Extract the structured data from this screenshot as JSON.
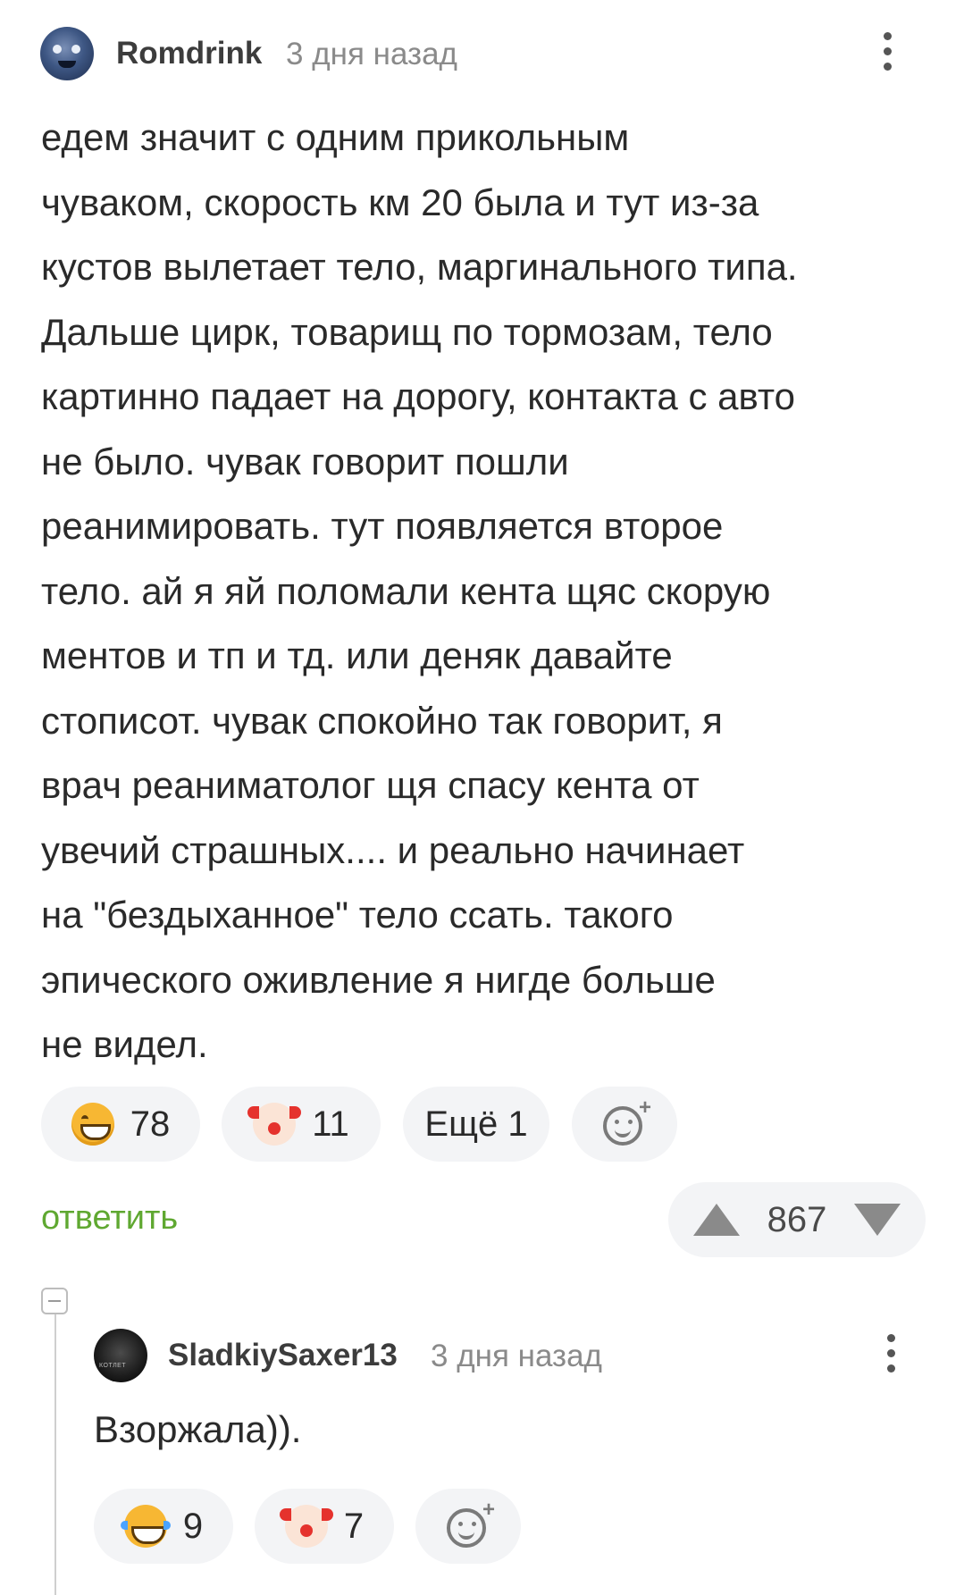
{
  "comment": {
    "username": "Romdrink",
    "time": "3 дня назад",
    "text_lines": [
      "едем значит с одним прикольным",
      "чуваком, скорость км 20 была и тут из-за",
      "кустов вылетает тело, маргинального типа.",
      "Дальше цирк, товарищ по тормозам, тело",
      "картинно падает на дорогу, контакта с авто",
      "не было. чувак говорит пошли",
      "реанимировать. тут появляется второе",
      "тело. ай я яй поломали кента щяс скорую",
      "ментов и тп и тд. или деняк давайте",
      "стописот. чувак спокойно так говорит, я",
      "врач реаниматолог щя спасу кента от",
      "увечий страшных.... и реально начинает",
      "на \"бездыханное\" тело ссать. такого",
      "эпического оживление я нигде больше",
      "не видел."
    ],
    "reactions": [
      {
        "icon": "grinning-face-emoji",
        "count": "78"
      },
      {
        "icon": "clown-face-emoji",
        "count": "11"
      }
    ],
    "more_reactions_label": "Ещё 1",
    "reply_label": "ответить",
    "rating": "867"
  },
  "reply": {
    "username": "SladkiySaxer13",
    "time": "3 дня назад",
    "text": "Взоржала)).",
    "reactions": [
      {
        "icon": "tears-of-joy-emoji",
        "count": "9"
      },
      {
        "icon": "clown-face-emoji",
        "count": "7"
      }
    ]
  },
  "colors": {
    "accent_green": "#5fa831",
    "pill_background": "#f3f4f6",
    "muted_text": "#8a8a8a"
  }
}
